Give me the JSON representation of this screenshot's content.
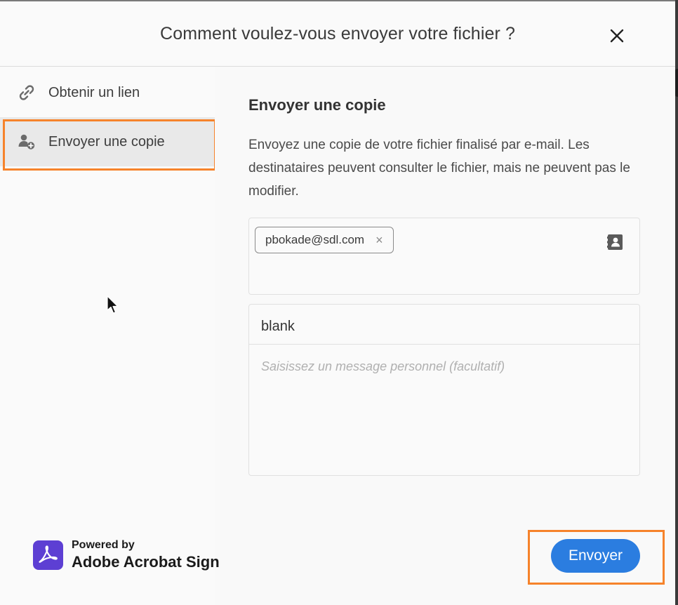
{
  "dialog": {
    "title": "Comment voulez-vous envoyer votre fichier ?"
  },
  "sidebar": {
    "items": [
      {
        "label": "Obtenir un lien",
        "icon": "link-icon",
        "selected": false
      },
      {
        "label": "Envoyer une copie",
        "icon": "add-person-icon",
        "selected": true
      }
    ]
  },
  "main": {
    "section_title": "Envoyer une copie",
    "description": "Envoyez une copie de votre fichier finalisé par e-mail. Les destinataires peuvent consulter le fichier, mais ne peuvent pas le modifier.",
    "recipients": [
      {
        "email": "pbokade@sdl.com",
        "remove_glyph": "×"
      }
    ],
    "subject_value": "blank",
    "message_placeholder": "Saisissez un message personnel (facultatif)"
  },
  "footer": {
    "powered_by": "Powered by",
    "brand": "Adobe Acrobat Sign",
    "send_label": "Envoyer"
  },
  "colors": {
    "accent": "#2b7de0",
    "highlight": "#f6832b",
    "logo": "#5d3fd3"
  }
}
